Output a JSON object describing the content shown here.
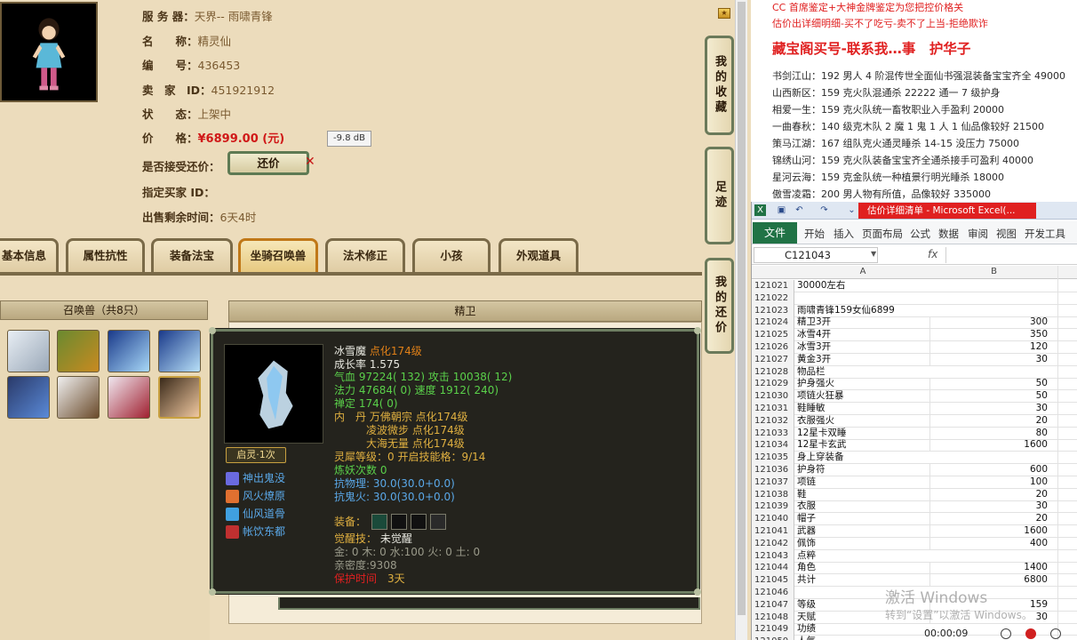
{
  "game": {
    "info": [
      {
        "label": "服 务 器：",
        "value": "天界-- 雨啸青锋"
      },
      {
        "label": "名　　称：",
        "value": "精灵仙"
      },
      {
        "label": "编　　号：",
        "value": "436453"
      },
      {
        "label": "卖　家　ID：",
        "value": "451921912"
      },
      {
        "label": "状　　态：",
        "value": "上架中"
      },
      {
        "label": "价　　格：",
        "value": "¥6899.00 (元)"
      },
      {
        "label": "是否接受还价：",
        "value": ""
      },
      {
        "label": "指定买家 ID：",
        "value": ""
      },
      {
        "label": "出售剩余时间：",
        "value": "6天4时"
      }
    ],
    "db_tip": "-9.8 dB",
    "bargain_button": "还价",
    "tabs": [
      "基本信息",
      "属性抗性",
      "装备法宝",
      "坐骑召唤兽",
      "法术修正",
      "小孩",
      "外观道具"
    ],
    "active_tab": 3,
    "side_buttons": [
      "我的收藏",
      "足迹",
      "我的还价"
    ],
    "pet_list_header": "召唤兽（共8只）",
    "detail_header": "精卫",
    "pet_tip": {
      "name": "冰雪魔",
      "level": "点化174级",
      "lines": [
        {
          "parts": [
            {
              "t": "成长率 1.575",
              "c": "c-white"
            }
          ]
        },
        {
          "parts": [
            {
              "t": "气血 ",
              "c": "c-green"
            },
            {
              "t": "97224( 132) ",
              "c": "c-green"
            },
            {
              "t": "攻击 ",
              "c": "c-green"
            },
            {
              "t": "10038( 12)",
              "c": "c-green"
            }
          ]
        },
        {
          "parts": [
            {
              "t": "法力 ",
              "c": "c-green"
            },
            {
              "t": "47684( 0) ",
              "c": "c-green"
            },
            {
              "t": "速度 ",
              "c": "c-green"
            },
            {
              "t": "1912( 240)",
              "c": "c-green"
            }
          ]
        },
        {
          "parts": [
            {
              "t": "禅定 174( 0)",
              "c": "c-green"
            }
          ]
        },
        {
          "parts": [
            {
              "t": "内　丹 万佛朝宗 点化174级",
              "c": "c-gold"
            }
          ]
        },
        {
          "parts": [
            {
              "t": "　　　凌波微步 点化174级",
              "c": "c-gold"
            }
          ]
        },
        {
          "parts": [
            {
              "t": "　　　大海无量 点化174级",
              "c": "c-gold"
            }
          ]
        },
        {
          "parts": [
            {
              "t": "灵犀等级：0 开启技能格：9/14",
              "c": "c-gold"
            }
          ]
        },
        {
          "parts": [
            {
              "t": "炼妖次数 0",
              "c": "c-green"
            }
          ]
        },
        {
          "parts": [
            {
              "t": "抗物理: 30.0(30.0+0.0)",
              "c": "c-blue"
            }
          ]
        },
        {
          "parts": [
            {
              "t": "抗鬼火: 30.0(30.0+0.0)",
              "c": "c-blue"
            }
          ]
        }
      ],
      "equip_label": "装备：",
      "awaken_label": "觉醒技：",
      "awaken_value": "未觉醒",
      "elements": "金: 0 木: 0 水:100 火: 0 土: 0",
      "intimacy": "亲密度:9308",
      "protect_label": "保护时间",
      "protect_value": "3天",
      "qiling": "启灵·1次",
      "skills": [
        {
          "name": "神出鬼没",
          "color": "#6a6ae0"
        },
        {
          "name": "风火燎原",
          "color": "#e07030"
        },
        {
          "name": "仙风道骨",
          "color": "#40a0e0"
        },
        {
          "name": "帐饮东都",
          "color": "#c03030"
        }
      ]
    }
  },
  "doc": {
    "lines": [
      {
        "text": "CC 首席鉴定+大神金牌鉴定为您把控价格关",
        "style": "doc-red"
      },
      {
        "text": "估价出详细明细-买不了吃亏-卖不了上当-拒绝欺诈",
        "style": "doc-red"
      },
      {
        "text": "藏宝阁买号-联系我…事　护华子",
        "style": "doc-big"
      },
      {
        "text": "书剑江山：192 男人 4 阶混传世全面仙书强混装备宝宝齐全 49000",
        "style": ""
      },
      {
        "text": "山西新区：159 克火队混通杀 22222 通一 7 级护身",
        "style": ""
      },
      {
        "text": "相爱一生：159 克火队统一畜牧职业入手盈利 20000",
        "style": ""
      },
      {
        "text": "一曲春秋：140 级克木队 2 魔 1 鬼 1 人 1 仙品像较好 21500",
        "style": ""
      },
      {
        "text": "策马江湖：167 组队克火通灵睡杀 14-15 没压力 75000",
        "style": ""
      },
      {
        "text": "锦绣山河：159 克火队装备宝宝齐全通杀接手可盈利 40000",
        "style": ""
      },
      {
        "text": "星河云海：159 克金队统一种植景行明光睡杀 18000",
        "style": ""
      },
      {
        "text": "傲雪凌霜：200 男人物有所值，品像较好 335000",
        "style": ""
      }
    ]
  },
  "excel": {
    "title": "估价详细清单 - Microsoft Excel(...",
    "file_tab": "文件",
    "ribbon_tabs": [
      "开始",
      "插入",
      "页面布局",
      "公式",
      "数据",
      "审阅",
      "视图",
      "开发工具"
    ],
    "name_box": "C121043",
    "fx": "fx",
    "col_headers": [
      "A",
      "B"
    ],
    "rows": [
      {
        "n": "121021",
        "a": "30000左右",
        "b": ""
      },
      {
        "n": "121022",
        "a": "",
        "b": ""
      },
      {
        "n": "121023",
        "a": "雨啸青锋159女仙6899",
        "b": ""
      },
      {
        "n": "121024",
        "a": "精卫3开",
        "b": "300"
      },
      {
        "n": "121025",
        "a": "冰雪4开",
        "b": "350"
      },
      {
        "n": "121026",
        "a": "冰雪3开",
        "b": "120"
      },
      {
        "n": "121027",
        "a": "黄金3开",
        "b": "30"
      },
      {
        "n": "121028",
        "a": "物品栏",
        "b": ""
      },
      {
        "n": "121029",
        "a": "护身强火",
        "b": "50"
      },
      {
        "n": "121030",
        "a": "项链火狂暴",
        "b": "50"
      },
      {
        "n": "121031",
        "a": "鞋睡敏",
        "b": "30"
      },
      {
        "n": "121032",
        "a": "衣服强火",
        "b": "20"
      },
      {
        "n": "121033",
        "a": "12星卡双睡",
        "b": "80"
      },
      {
        "n": "121034",
        "a": "12星卡玄武",
        "b": "1600"
      },
      {
        "n": "121035",
        "a": "身上穿装备",
        "b": ""
      },
      {
        "n": "121036",
        "a": "护身符",
        "b": "600"
      },
      {
        "n": "121037",
        "a": "项链",
        "b": "100"
      },
      {
        "n": "121038",
        "a": "鞋",
        "b": "20"
      },
      {
        "n": "121039",
        "a": "衣服",
        "b": "30"
      },
      {
        "n": "121040",
        "a": "帽子",
        "b": "20"
      },
      {
        "n": "121041",
        "a": "武器",
        "b": "1600"
      },
      {
        "n": "121042",
        "a": "佩饰",
        "b": "400"
      },
      {
        "n": "121043",
        "a": "点粹",
        "b": ""
      },
      {
        "n": "121044",
        "a": "角色",
        "b": "1400"
      },
      {
        "n": "121045",
        "a": "共计",
        "b": "6800"
      },
      {
        "n": "121046",
        "a": "",
        "b": ""
      },
      {
        "n": "121047",
        "a": "等级",
        "b": "159"
      },
      {
        "n": "121048",
        "a": "天赋",
        "b": "30"
      },
      {
        "n": "121049",
        "a": "功绩",
        "b": ""
      },
      {
        "n": "121050",
        "a": "人气",
        "b": ""
      }
    ]
  },
  "overlay": {
    "activate_title": "激活 Windows",
    "activate_sub": "转到“设置”以激活 Windows。",
    "time": "00:00:09"
  }
}
